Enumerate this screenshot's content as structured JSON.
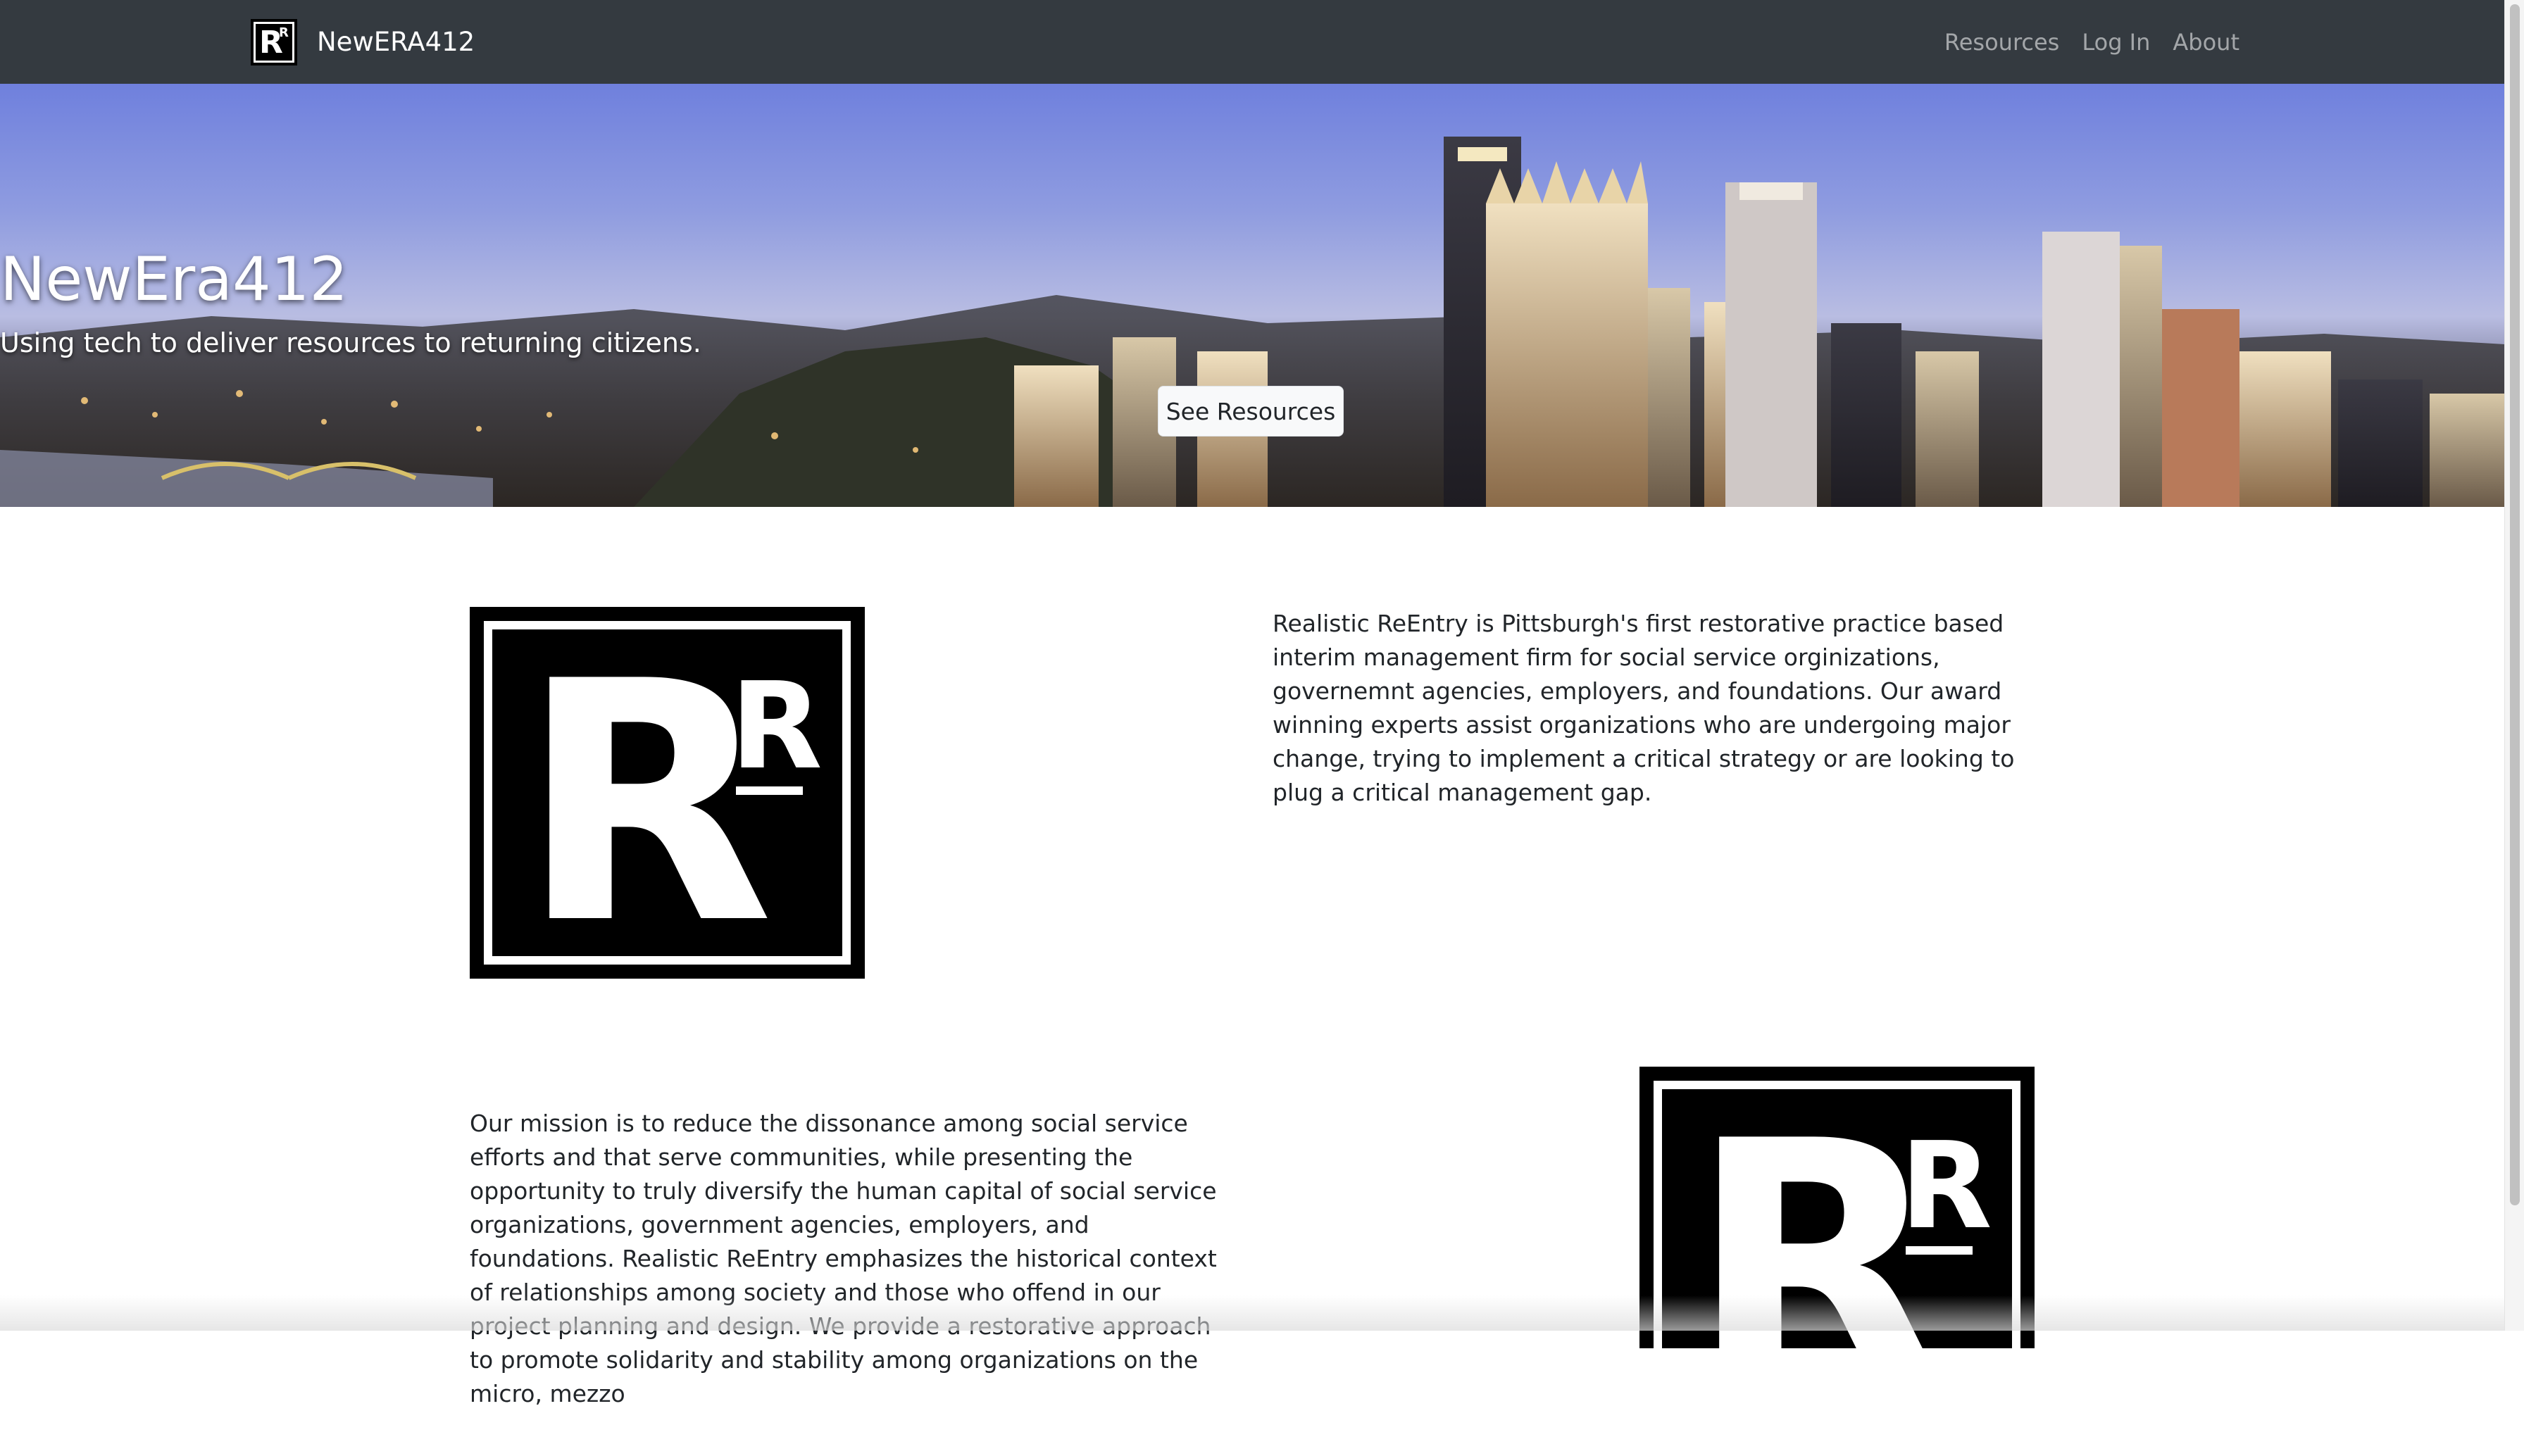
{
  "navbar": {
    "brand_name": "NewERA412",
    "logo_letters": {
      "big": "R",
      "small": "R"
    },
    "links": [
      "Resources",
      "Log In",
      "About"
    ]
  },
  "hero": {
    "title": "NewEra412",
    "subtitle": "Using tech to deliver resources to returning citizens.",
    "button_label": "See Resources"
  },
  "content": {
    "logo_letters": {
      "big": "R",
      "small": "R"
    },
    "paragraph1": "Realistic ReEntry is Pittsburgh's first restorative practice based interim management firm for social service orginizations, governemnt agencies, employers, and foundations. Our award winning experts assist organizations who are undergoing major change, trying to implement a critical strategy or are looking to plug a critical management gap.",
    "paragraph2": "Our mission is to reduce the dissonance among social service efforts and that serve communities, while presenting the opportunity to truly diversify the human capital of social service organizations, government agencies, employers, and foundations. Realistic ReEntry emphasizes the historical context of relationships among society and those who offend in our project planning and design. We provide a restorative approach to promote solidarity and stability among organizations on the micro, mezzo"
  },
  "colors": {
    "navbar_bg": "#343a40",
    "nav_link": "rgba(255,255,255,0.55)",
    "text": "#212529"
  },
  "icons": {
    "brand_logo": "realistic-reentry-logo-icon",
    "hero_image": "pittsburgh-skyline-image"
  }
}
